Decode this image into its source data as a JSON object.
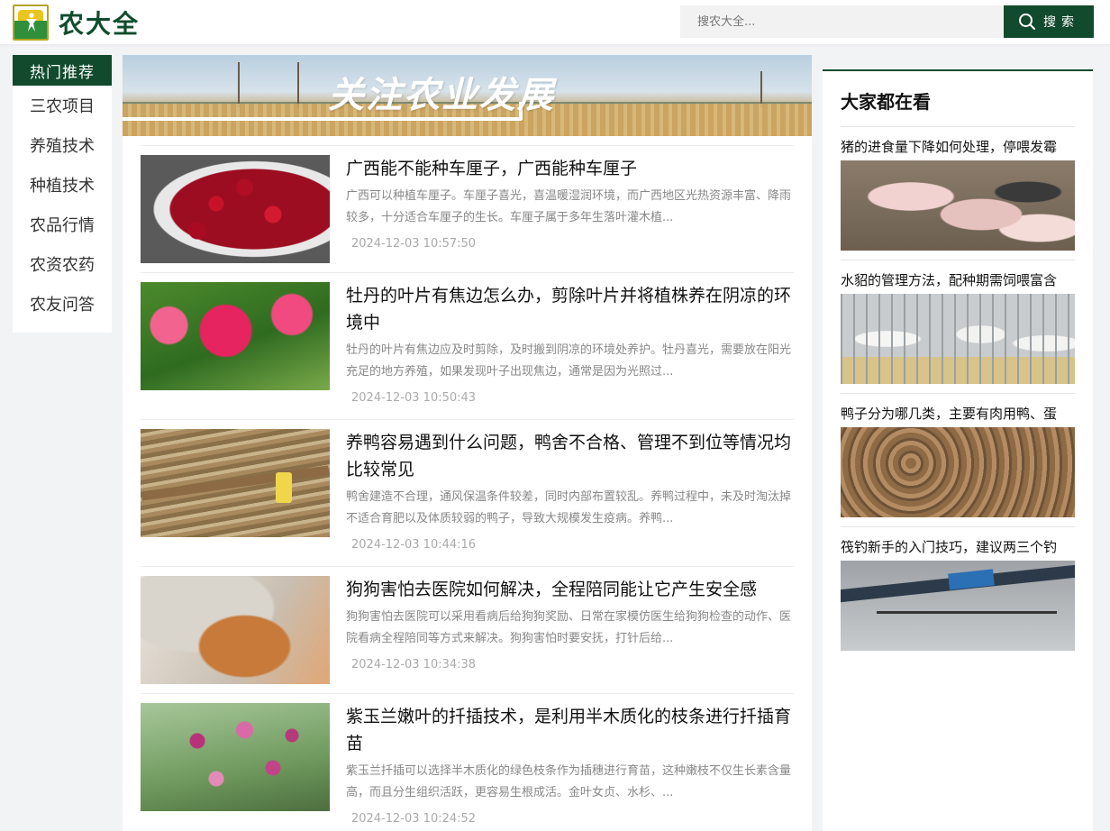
{
  "header": {
    "logo_text": "农大全",
    "search_placeholder": "搜农大全...",
    "search_button": "搜索"
  },
  "leftnav": {
    "heading": "热门推荐",
    "items": [
      "三农项目",
      "养殖技术",
      "种植技术",
      "农品行情",
      "农资农药",
      "农友问答"
    ]
  },
  "banner": {
    "title": "关注农业发展"
  },
  "articles": [
    {
      "title": "广西能不能种车厘子，广西能种车厘子",
      "desc": "广西可以种植车厘子。车厘子喜光，喜温暖湿润环境，而广西地区光热资源丰富、降雨较多，十分适合车厘子的生长。车厘子属于多年生落叶灌木植...",
      "time": "2024-12-03 10:57:50"
    },
    {
      "title": "牡丹的叶片有焦边怎么办，剪除叶片并将植株养在阴凉的环境中",
      "desc": "牡丹的叶片有焦边应及时剪除，及时搬到阴凉的环境处养护。牡丹喜光，需要放在阳光充足的地方养殖，如果发现叶子出现焦边，通常是因为光照过...",
      "time": "2024-12-03 10:50:43"
    },
    {
      "title": "养鸭容易遇到什么问题，鸭舍不合格、管理不到位等情况均比较常见",
      "desc": "鸭舍建造不合理，通风保温条件较差，同时内部布置较乱。养鸭过程中，未及时淘汰掉不适合育肥以及体质较弱的鸭子，导致大规模发生疫病。养鸭...",
      "time": "2024-12-03 10:44:16"
    },
    {
      "title": "狗狗害怕去医院如何解决，全程陪同能让它产生安全感",
      "desc": "狗狗害怕去医院可以采用看病后给狗狗奖励、日常在家模仿医生给狗狗检查的动作、医院看病全程陪同等方式来解决。狗狗害怕时要安抚，打针后给...",
      "time": "2024-12-03 10:34:38"
    },
    {
      "title": "紫玉兰嫩叶的扦插技术，是利用半木质化的枝条进行扦插育苗",
      "desc": "紫玉兰扦插可以选择半木质化的绿色枝条作为插穗进行育苗，这种嫩枝不仅生长素含量高，而且分生组织活跃，更容易生根成活。金叶女贞、水杉、...",
      "time": "2024-12-03 10:24:52"
    }
  ],
  "right": {
    "heading": "大家都在看",
    "items": [
      {
        "title": "猪的进食量下降如何处理，停喂发霉"
      },
      {
        "title": "水貂的管理方法，配种期需饲喂富含"
      },
      {
        "title": "鸭子分为哪几类，主要有肉用鸭、蛋"
      },
      {
        "title": "筏钓新手的入门技巧，建议两三个钓"
      }
    ]
  },
  "colors": {
    "brand_green": "#124a2d",
    "background": "#f2f3f5"
  }
}
